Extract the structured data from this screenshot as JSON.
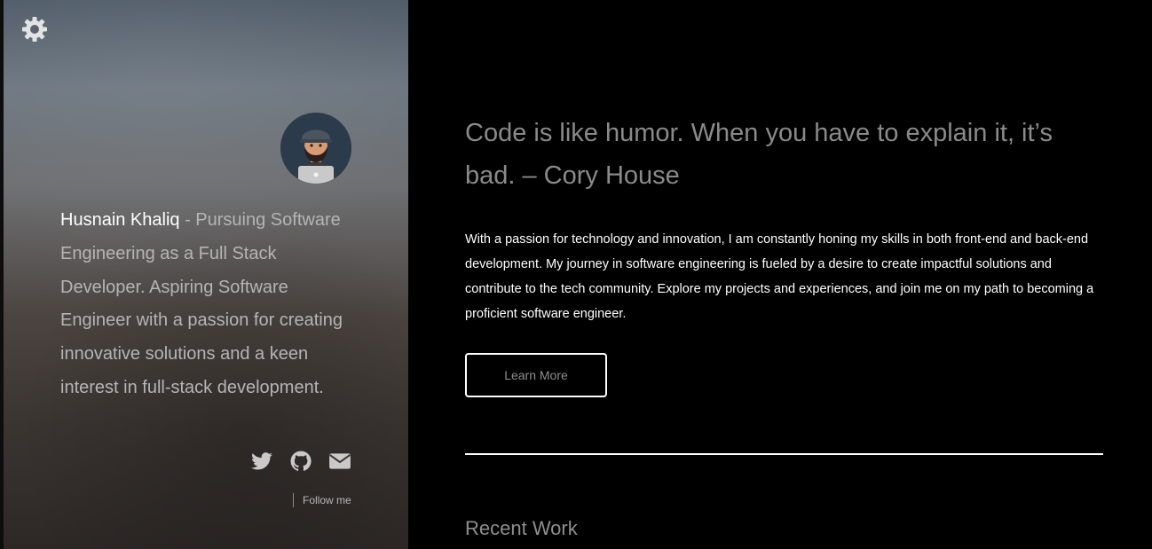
{
  "sidebar": {
    "settings_icon": "gear-icon",
    "avatar_icon": "avatar-memoji-icon",
    "name": "Husnain Khaliq",
    "bio_text": " - Pursuing Software Engineering as a Full Stack Developer. Aspiring Software Engineer with a passion for creating innovative solutions and a keen interest in full-stack development.",
    "social": [
      {
        "icon": "twitter-icon"
      },
      {
        "icon": "github-icon"
      },
      {
        "icon": "email-icon"
      }
    ],
    "follow_label": "Follow me"
  },
  "main": {
    "quote": "Code is like humor. When you have to explain it, it’s bad. – Cory House",
    "intro": "With a passion for technology and innovation, I am constantly honing my skills in both front-end and back-end development. My journey in software engineering is fueled by a desire to create impactful solutions and contribute to the tech community. Explore my projects and experiences, and join me on my path to becoming a proficient software engineer.",
    "learn_more_label": "Learn More",
    "recent_work_title": "Recent Work"
  },
  "colors": {
    "background": "#000000",
    "text_primary": "#ffffff",
    "text_muted": "#8a8a8a",
    "sidebar_text": "#b5b5b5"
  }
}
